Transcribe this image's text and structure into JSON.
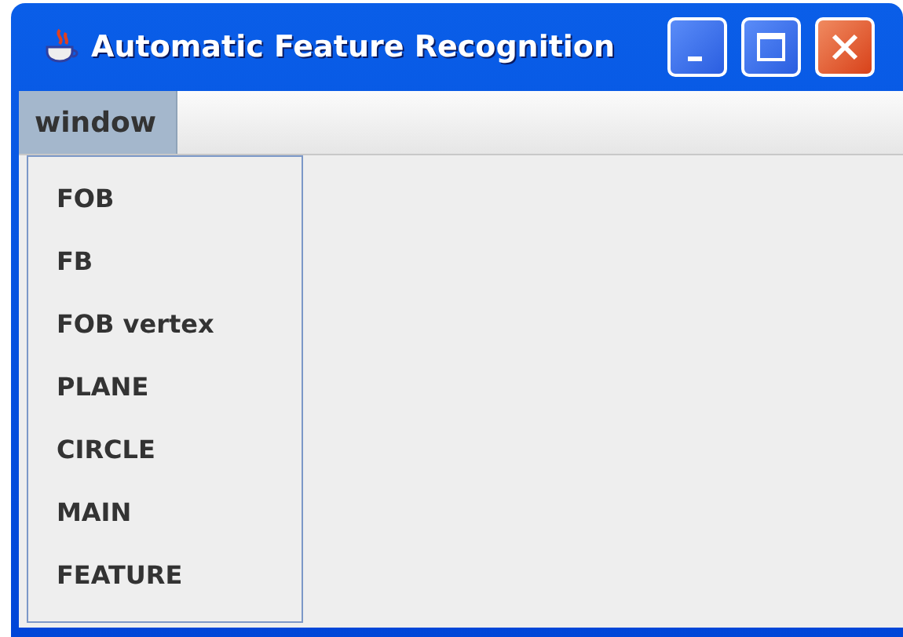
{
  "window": {
    "title": "Automatic Feature Recognition"
  },
  "menu_bar": {
    "menus": [
      {
        "label": "window",
        "open": true
      }
    ]
  },
  "dropdown": {
    "items": [
      {
        "label": "FOB"
      },
      {
        "label": "FB"
      },
      {
        "label": "FOB vertex"
      },
      {
        "label": "PLANE"
      },
      {
        "label": "CIRCLE"
      },
      {
        "label": "MAIN"
      },
      {
        "label": "FEATURE"
      }
    ]
  }
}
